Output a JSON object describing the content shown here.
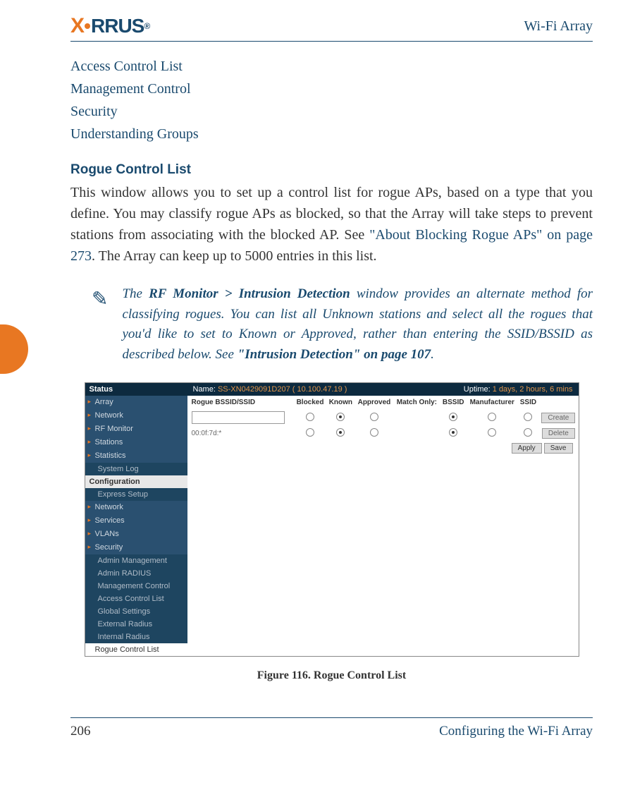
{
  "header": {
    "logo_text": "X RRUS",
    "right": "Wi-Fi Array"
  },
  "links": [
    "Access Control List",
    "Management Control",
    "Security",
    "Understanding Groups"
  ],
  "section": {
    "title": "Rogue Control List",
    "paragraph_start": "This window allows you to set up a control list for rogue APs, based on a type that you define. You may classify rogue APs as blocked, so that the Array will take steps to prevent stations from associating with the blocked AP. See ",
    "link_text": "\"About Blocking Rogue APs\" on page 273",
    "paragraph_end": ". The Array can keep up to 5000 entries in this list."
  },
  "note": {
    "text_start": "The ",
    "bold_1": "RF Monitor > Intrusion Detection",
    "text_mid": " window provides an alternate method for classifying rogues. You can list all Unknown stations and select all the rogues that you'd like to set to Known or Approved, rather than entering the SSID/BSSID as described below. See ",
    "bold_2": "\"Intrusion Detection\" on page 107",
    "text_end": "."
  },
  "screenshot": {
    "sidebar": {
      "status_label": "Status",
      "nav_top": [
        "Array",
        "Network",
        "RF Monitor",
        "Stations",
        "Statistics"
      ],
      "sub_top": [
        "System Log"
      ],
      "config_header": "Configuration",
      "sub_config": [
        "Express Setup"
      ],
      "nav_config": [
        "Network",
        "Services",
        "VLANs",
        "Security"
      ],
      "sub_security": [
        "Admin Management",
        "Admin RADIUS",
        "Management Control",
        "Access Control List",
        "Global Settings",
        "External Radius",
        "Internal Radius"
      ],
      "active": "Rogue Control List"
    },
    "topbar": {
      "name_label": "Name:",
      "name_value": "SS-XN0429091D207",
      "ip": "( 10.100.47.19 )",
      "uptime_label": "Uptime:",
      "uptime_value": "1 days, 2 hours, 6 mins"
    },
    "table": {
      "headers": [
        "Rogue BSSID/SSID",
        "Blocked",
        "Known",
        "Approved",
        "Match Only:",
        "BSSID",
        "Manufacturer",
        "SSID",
        ""
      ],
      "row1_id": "00:0f:7d:*",
      "buttons": {
        "create": "Create",
        "delete": "Delete",
        "apply": "Apply",
        "save": "Save"
      }
    }
  },
  "figure_caption": "Figure 116. Rogue Control List",
  "footer": {
    "page": "206",
    "title": "Configuring the Wi-Fi Array"
  }
}
